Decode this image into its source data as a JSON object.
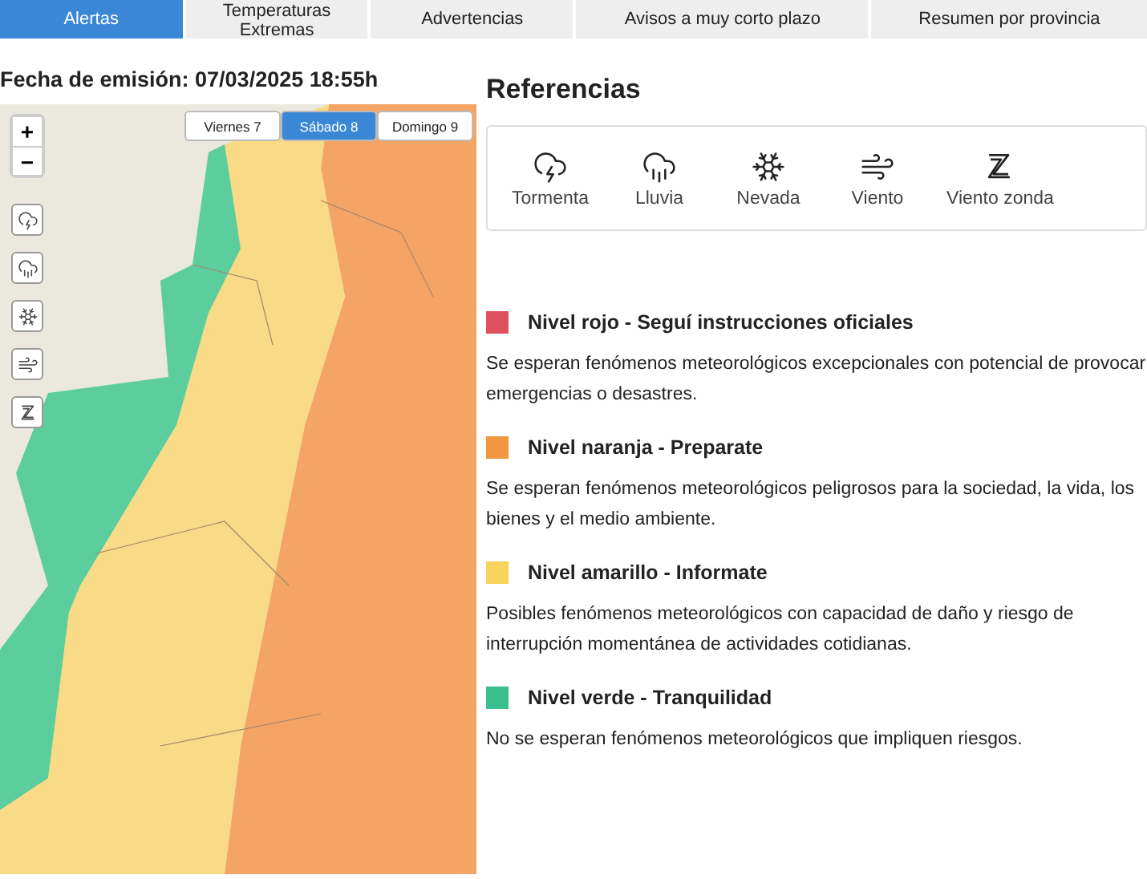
{
  "tabs": [
    {
      "label": "Alertas",
      "selected": true
    },
    {
      "label": "Temperaturas Extremas",
      "selected": false
    },
    {
      "label": "Advertencias",
      "selected": false
    },
    {
      "label": "Avisos a muy corto plazo",
      "selected": false
    },
    {
      "label": "Resumen por provincia",
      "selected": false
    }
  ],
  "issue_date": "Fecha de emisión: 07/03/2025 18:55h",
  "map": {
    "zoom_in": "+",
    "zoom_out": "−",
    "days": [
      {
        "label": "Viernes 7",
        "selected": false
      },
      {
        "label": "Sábado 8",
        "selected": true
      },
      {
        "label": "Domingo 9",
        "selected": false
      }
    ],
    "layer_buttons": [
      {
        "kind": "storm"
      },
      {
        "kind": "rain"
      },
      {
        "kind": "snow"
      },
      {
        "kind": "wind"
      },
      {
        "kind": "zonda"
      }
    ]
  },
  "references": {
    "title": "Referencias",
    "phenomena": [
      {
        "kind": "storm",
        "label": "Tormenta"
      },
      {
        "kind": "rain",
        "label": "Lluvia"
      },
      {
        "kind": "snow",
        "label": "Nevada"
      },
      {
        "kind": "wind",
        "label": "Viento"
      },
      {
        "kind": "zonda",
        "label": "Viento zonda"
      }
    ],
    "levels": [
      {
        "color": "#e0505e",
        "title": "Nivel rojo - Seguí instrucciones oficiales",
        "description": "Se esperan fenómenos meteorológicos excepcionales con potencial de provocar emergencias o desastres."
      },
      {
        "color": "#f2963f",
        "title": "Nivel naranja - Preparate",
        "description": "Se esperan fenómenos meteorológicos peligrosos para la sociedad, la vida, los bienes y el medio ambiente."
      },
      {
        "color": "#f8d45c",
        "title": "Nivel amarillo - Informate",
        "description": "Posibles fenómenos meteorológicos con capacidad de daño y riesgo de interrupción momentánea de actividades cotidianas."
      },
      {
        "color": "#3bbf8f",
        "title": "Nivel verde - Tranquilidad",
        "description": "No se esperan fenómenos meteorológicos que impliquen riesgos."
      }
    ]
  }
}
